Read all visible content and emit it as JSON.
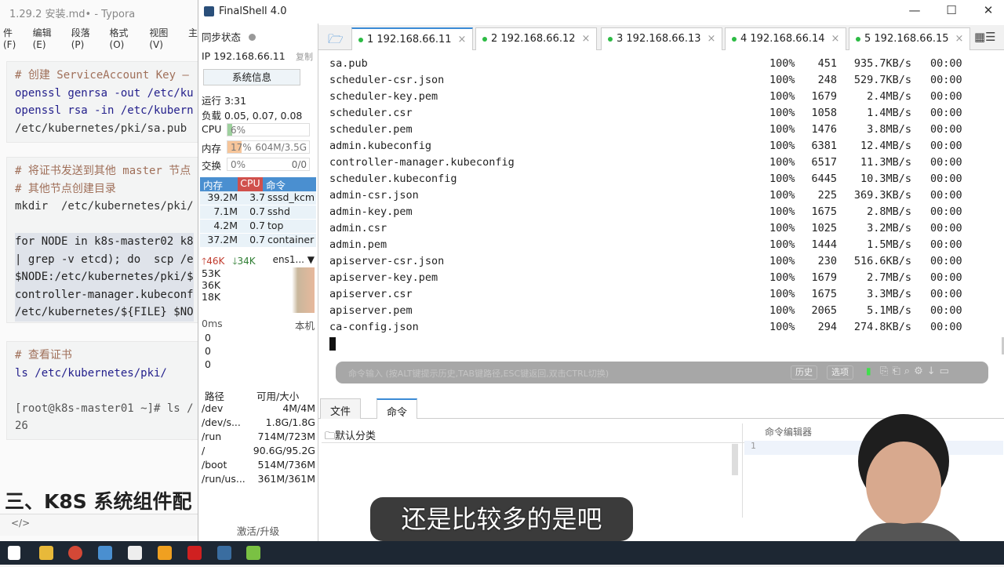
{
  "typora": {
    "title": "1.29.2 安装.md• - Typora",
    "menu": [
      "件(F)",
      "编辑(E)",
      "段落(P)",
      "格式(O)",
      "视图(V)",
      "主"
    ],
    "block1": [
      "# 创建 ServiceAccount Key —",
      "openssl genrsa -out /etc/ku",
      "openssl rsa -in /etc/kubern",
      "/etc/kubernetes/pki/sa.pub"
    ],
    "block2": [
      "# 将证书发送到其他 master 节点",
      "# 其他节点创建目录",
      "mkdir  /etc/kubernetes/pki/",
      "",
      "for NODE in k8s-master02 k8",
      "| grep -v etcd); do  scp /e",
      "$NODE:/etc/kubernetes/pki/$",
      "controller-manager.kubeconf",
      "/etc/kubernetes/${FILE} $NO"
    ],
    "block3": [
      "# 查看证书",
      "ls /etc/kubernetes/pki/",
      "",
      "[root@k8s-master01 ~]# ls /",
      "26"
    ],
    "heading": "三、K8S 系统组件配",
    "status": "</>"
  },
  "finalshell": {
    "title": "FinalShell 4.0",
    "left": {
      "sync": "同步状态",
      "ip_label": "IP",
      "ip": "192.168.66.11",
      "copy": "复制",
      "sysinfo": "系统信息",
      "uptime": "运行 3:31",
      "load": "负载 0.05, 0.07, 0.08",
      "cpu_label": "CPU",
      "cpu": "6%",
      "cpu_frac": 0.06,
      "mem_label": "内存",
      "mem": "17%",
      "mem_frac": 0.17,
      "mem_detail": "604M/3.5G",
      "swap_label": "交换",
      "swap": "0%",
      "swap_detail": "0/0",
      "proc_headers": [
        "内存",
        "CPU",
        "命令"
      ],
      "procs": [
        [
          "39.2M",
          "3.7",
          "sssd_kcm"
        ],
        [
          "7.1M",
          "0.7",
          "sshd"
        ],
        [
          "4.2M",
          "0.7",
          "top"
        ],
        [
          "37.2M",
          "0.7",
          "container"
        ]
      ],
      "net_up": "46K",
      "net_down": "34K",
      "iface": "ens1...",
      "net_ticks": [
        "53K",
        "36K",
        "18K"
      ],
      "ping": "0ms",
      "ping_host": "本机",
      "ping_vals": [
        "0",
        "0",
        "0"
      ],
      "disk_headers": [
        "路径",
        "可用/大小"
      ],
      "disks": [
        [
          "/dev",
          "4M/4M"
        ],
        [
          "/dev/s...",
          "1.8G/1.8G"
        ],
        [
          "/run",
          "714M/723M"
        ],
        [
          "/",
          "90.6G/95.2G"
        ],
        [
          "/boot",
          "514M/736M"
        ],
        [
          "/run/us...",
          "361M/361M"
        ]
      ],
      "activate": "激活/升级"
    },
    "tabs": [
      {
        "label": "1 192.168.66.11"
      },
      {
        "label": "2 192.168.66.12"
      },
      {
        "label": "3 192.168.66.13"
      },
      {
        "label": "4 192.168.66.14"
      },
      {
        "label": "5 192.168.66.15"
      }
    ],
    "terminal": [
      [
        "sa.pub",
        "100%",
        "451",
        "935.7KB/s",
        "00:00"
      ],
      [
        "scheduler-csr.json",
        "100%",
        "248",
        "529.7KB/s",
        "00:00"
      ],
      [
        "scheduler-key.pem",
        "100%",
        "1679",
        "2.4MB/s",
        "00:00"
      ],
      [
        "scheduler.csr",
        "100%",
        "1058",
        "1.4MB/s",
        "00:00"
      ],
      [
        "scheduler.pem",
        "100%",
        "1476",
        "3.8MB/s",
        "00:00"
      ],
      [
        "admin.kubeconfig",
        "100%",
        "6381",
        "12.4MB/s",
        "00:00"
      ],
      [
        "controller-manager.kubeconfig",
        "100%",
        "6517",
        "11.3MB/s",
        "00:00"
      ],
      [
        "scheduler.kubeconfig",
        "100%",
        "6445",
        "10.3MB/s",
        "00:00"
      ],
      [
        "admin-csr.json",
        "100%",
        "225",
        "369.3KB/s",
        "00:00"
      ],
      [
        "admin-key.pem",
        "100%",
        "1675",
        "2.8MB/s",
        "00:00"
      ],
      [
        "admin.csr",
        "100%",
        "1025",
        "3.2MB/s",
        "00:00"
      ],
      [
        "admin.pem",
        "100%",
        "1444",
        "1.5MB/s",
        "00:00"
      ],
      [
        "apiserver-csr.json",
        "100%",
        "230",
        "516.6KB/s",
        "00:00"
      ],
      [
        "apiserver-key.pem",
        "100%",
        "1679",
        "2.7MB/s",
        "00:00"
      ],
      [
        "apiserver.csr",
        "100%",
        "1675",
        "3.3MB/s",
        "00:00"
      ],
      [
        "apiserver.pem",
        "100%",
        "2065",
        "5.1MB/s",
        "00:00"
      ],
      [
        "ca-config.json",
        "100%",
        "294",
        "274.8KB/s",
        "00:00"
      ]
    ],
    "cmd_placeholder": "命令输入 (按ALT键提示历史,TAB键路径,ESC键返回,双击CTRL切换)",
    "history": "历史",
    "options": "选项",
    "lower_tabs": [
      "文件",
      "命令"
    ],
    "category": "默认分类",
    "editor_title": "命令编辑器",
    "editor_line": "1"
  },
  "subtitle": "还是比较多的是吧"
}
